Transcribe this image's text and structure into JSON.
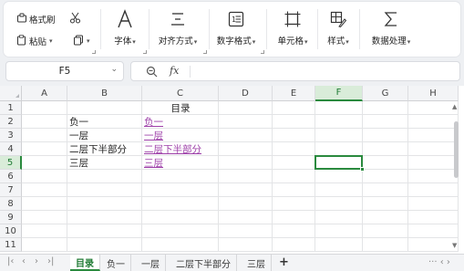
{
  "ribbon": {
    "format_painter": "格式刷",
    "paste": "粘贴",
    "font": "字体",
    "alignment": "对齐方式",
    "number_format": "数字格式",
    "cells": "单元格",
    "styles": "样式",
    "data_processing": "数据处理"
  },
  "formula_bar": {
    "cell_ref": "F5",
    "fx": "fx",
    "value": ""
  },
  "columns": [
    "A",
    "B",
    "C",
    "D",
    "E",
    "F",
    "G",
    "H"
  ],
  "rows": [
    "1",
    "2",
    "3",
    "4",
    "5",
    "6",
    "7",
    "8",
    "9",
    "10",
    "11"
  ],
  "active_cell": {
    "column": "F",
    "row": "5"
  },
  "cells": {
    "C1": "目录",
    "B2": "负一",
    "C2": "负一",
    "B3": "一层",
    "C3": "一层",
    "B4": "二层下半部分",
    "C4": "二层下半部分",
    "B5": "三层",
    "C5": "三层"
  },
  "sheet_tabs": [
    "目录",
    "负一",
    "一层",
    "二层下半部分",
    "三层"
  ],
  "active_tab": "目录",
  "colors": {
    "accent": "#2a8a3e",
    "link": "#9d3fa8"
  }
}
